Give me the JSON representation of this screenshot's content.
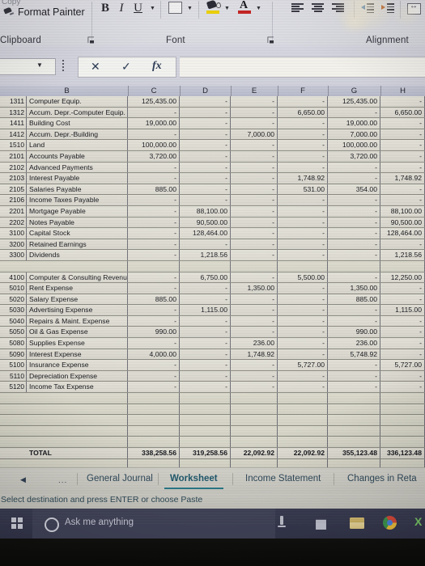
{
  "ribbon": {
    "cut_label": "Copy",
    "format_painter_label": "Format Painter",
    "bold_label": "B",
    "italic_label": "I",
    "underline_label": "U",
    "font_color_letter": "A",
    "groups": {
      "clipboard": "Clipboard",
      "font": "Font",
      "alignment": "Alignment"
    },
    "dialog_launcher": "⌐",
    "icons": {
      "format_painter": "paintbrush-icon",
      "borders": "borders-icon",
      "fill_color": "fill-color-icon",
      "font_color": "font-color-icon",
      "align_left": "align-left-icon",
      "align_center": "align-center-icon",
      "align_right": "align-right-icon",
      "decrease_indent": "decrease-indent-icon",
      "increase_indent": "increase-indent-icon",
      "wrap_text": "wrap-text-icon"
    },
    "fill_swatch_color": "#f5d800",
    "font_color_swatch": "#cc2222"
  },
  "formula_bar": {
    "name_box_value": "",
    "cancel_label": "✕",
    "enter_label": "✓",
    "fx_label": "fx",
    "formula_value": ""
  },
  "sheet": {
    "columns": [
      "B",
      "C",
      "D",
      "E",
      "F",
      "G",
      "H"
    ],
    "rows": [
      {
        "code": "1311",
        "name": "Computer Equip.",
        "c": "125,435.00",
        "d": "-",
        "e": "-",
        "f": "-",
        "g": "125,435.00",
        "h": "-"
      },
      {
        "code": "1312",
        "name": "Accum. Depr.-Computer Equip.",
        "c": "-",
        "d": "-",
        "e": "-",
        "f": "6,650.00",
        "g": "-",
        "h": "6,650.00"
      },
      {
        "code": "1411",
        "name": "Building Cost",
        "c": "19,000.00",
        "d": "-",
        "e": "-",
        "f": "-",
        "g": "19,000.00",
        "h": "-"
      },
      {
        "code": "1412",
        "name": "Accum. Depr.-Building",
        "c": "-",
        "d": "-",
        "e": "7,000.00",
        "f": "-",
        "g": "7,000.00",
        "h": "-"
      },
      {
        "code": "1510",
        "name": "Land",
        "c": "100,000.00",
        "d": "-",
        "e": "-",
        "f": "-",
        "g": "100,000.00",
        "h": "-"
      },
      {
        "code": "2101",
        "name": "Accounts Payable",
        "c": "3,720.00",
        "d": "-",
        "e": "-",
        "f": "-",
        "g": "3,720.00",
        "h": "-"
      },
      {
        "code": "2102",
        "name": "Advanced Payments",
        "c": "-",
        "d": "-",
        "e": "-",
        "f": "-",
        "g": "-",
        "h": "-"
      },
      {
        "code": "2103",
        "name": "Interest Payable",
        "c": "-",
        "d": "-",
        "e": "-",
        "f": "1,748.92",
        "g": "-",
        "h": "1,748.92"
      },
      {
        "code": "2105",
        "name": "Salaries Payable",
        "c": "885.00",
        "d": "-",
        "e": "-",
        "f": "531.00",
        "g": "354.00",
        "h": "-"
      },
      {
        "code": "2106",
        "name": "Income Taxes Payable",
        "c": "-",
        "d": "-",
        "e": "-",
        "f": "-",
        "g": "-",
        "h": "-"
      },
      {
        "code": "2201",
        "name": "Mortgage Payable",
        "c": "-",
        "d": "88,100.00",
        "e": "-",
        "f": "-",
        "g": "-",
        "h": "88,100.00"
      },
      {
        "code": "2202",
        "name": "Notes Payable",
        "c": "-",
        "d": "90,500.00",
        "e": "-",
        "f": "-",
        "g": "-",
        "h": "90,500.00"
      },
      {
        "code": "3100",
        "name": "Capital Stock",
        "c": "-",
        "d": "128,464.00",
        "e": "-",
        "f": "-",
        "g": "-",
        "h": "128,464.00"
      },
      {
        "code": "3200",
        "name": "Retained Earnings",
        "c": "-",
        "d": "-",
        "e": "-",
        "f": "-",
        "g": "-",
        "h": "-"
      },
      {
        "code": "3300",
        "name": "Dividends",
        "c": "-",
        "d": "1,218.56",
        "e": "-",
        "f": "-",
        "g": "-",
        "h": "1,218.56"
      },
      {
        "code": "",
        "name": "",
        "c": "",
        "d": "",
        "e": "",
        "f": "",
        "g": "",
        "h": ""
      },
      {
        "code": "4100",
        "name": "Computer & Consulting Revenue",
        "c": "-",
        "d": "6,750.00",
        "e": "-",
        "f": "5,500.00",
        "g": "-",
        "h": "12,250.00"
      },
      {
        "code": "5010",
        "name": "Rent Expense",
        "c": "-",
        "d": "-",
        "e": "1,350.00",
        "f": "-",
        "g": "1,350.00",
        "h": "-"
      },
      {
        "code": "5020",
        "name": "Salary Expense",
        "c": "885.00",
        "d": "-",
        "e": "-",
        "f": "-",
        "g": "885.00",
        "h": "-"
      },
      {
        "code": "5030",
        "name": "Advertising Expense",
        "c": "-",
        "d": "1,115.00",
        "e": "-",
        "f": "-",
        "g": "-",
        "h": "1,115.00"
      },
      {
        "code": "5040",
        "name": "Repairs & Maint. Expense",
        "c": "-",
        "d": "-",
        "e": "-",
        "f": "-",
        "g": "-",
        "h": "-"
      },
      {
        "code": "5050",
        "name": "Oil & Gas Expense",
        "c": "990.00",
        "d": "-",
        "e": "-",
        "f": "-",
        "g": "990.00",
        "h": "-"
      },
      {
        "code": "5080",
        "name": "Supplies Expense",
        "c": "-",
        "d": "-",
        "e": "236.00",
        "f": "-",
        "g": "236.00",
        "h": "-"
      },
      {
        "code": "5090",
        "name": "Interest Expense",
        "c": "4,000.00",
        "d": "-",
        "e": "1,748.92",
        "f": "-",
        "g": "5,748.92",
        "h": "-"
      },
      {
        "code": "5100",
        "name": "Insurance Expense",
        "c": "-",
        "d": "-",
        "e": "-",
        "f": "5,727.00",
        "g": "-",
        "h": "5,727.00"
      },
      {
        "code": "5110",
        "name": "Depreciation Expense",
        "c": "-",
        "d": "-",
        "e": "-",
        "f": "-",
        "g": "-",
        "h": "-"
      },
      {
        "code": "5120",
        "name": "Income Tax Expense",
        "c": "-",
        "d": "-",
        "e": "-",
        "f": "-",
        "g": "-",
        "h": "-"
      },
      {
        "code": "",
        "name": "",
        "c": "",
        "d": "",
        "e": "",
        "f": "",
        "g": "",
        "h": ""
      },
      {
        "code": "",
        "name": "",
        "c": "",
        "d": "",
        "e": "",
        "f": "",
        "g": "",
        "h": ""
      },
      {
        "code": "",
        "name": "",
        "c": "",
        "d": "",
        "e": "",
        "f": "",
        "g": "",
        "h": ""
      },
      {
        "code": "",
        "name": "",
        "c": "",
        "d": "",
        "e": "",
        "f": "",
        "g": "",
        "h": ""
      },
      {
        "code": "",
        "name": "",
        "c": "",
        "d": "",
        "e": "",
        "f": "",
        "g": "",
        "h": ""
      },
      {
        "code": "",
        "name": "TOTAL",
        "c": "338,258.56",
        "d": "319,258.56",
        "e": "22,092.92",
        "f": "22,092.92",
        "g": "355,123.48",
        "h": "336,123.48"
      },
      {
        "code": "",
        "name": "",
        "c": "",
        "d": "",
        "e": "",
        "f": "",
        "g": "",
        "h": ""
      },
      {
        "code": "",
        "name": "",
        "c": "",
        "d": "",
        "e": "",
        "f": "",
        "g": "",
        "h": ""
      },
      {
        "code": "",
        "name": "",
        "c": "",
        "d": "",
        "e": "",
        "f": "",
        "g": "",
        "h": ""
      },
      {
        "code": "",
        "name": "",
        "c": "",
        "d": "",
        "e": "",
        "f": "",
        "g": "",
        "h": ""
      },
      {
        "code": "",
        "name": "",
        "c": "",
        "d": "",
        "e": "",
        "f": "",
        "g": "",
        "h": ""
      }
    ],
    "row_numbers": [
      "",
      "",
      "",
      "",
      "",
      "",
      "",
      "",
      "",
      "",
      "",
      "",
      "",
      "",
      "",
      "",
      "",
      "",
      "",
      "",
      "",
      "",
      "",
      "",
      "",
      "",
      "",
      "",
      "",
      "",
      "",
      "",
      "",
      "",
      "",
      "",
      "",
      ""
    ]
  },
  "tabs": {
    "nav_arrow": "◀",
    "overflow": "...",
    "items": [
      {
        "label": "General Journal",
        "active": false
      },
      {
        "label": "Worksheet",
        "active": true
      },
      {
        "label": "Income Statement",
        "active": false
      },
      {
        "label": "Changes in Reta",
        "active": false
      }
    ]
  },
  "status": {
    "message": "Select destination and press ENTER or choose Paste"
  },
  "taskbar": {
    "search_placeholder": "Ask me anything",
    "icons": {
      "start": "windows-start-icon",
      "cortana": "cortana-circle-icon",
      "task_view": "pen-icon",
      "store": "store-icon",
      "explorer": "file-explorer-icon",
      "chrome": "chrome-icon",
      "excel": "excel-icon"
    }
  }
}
